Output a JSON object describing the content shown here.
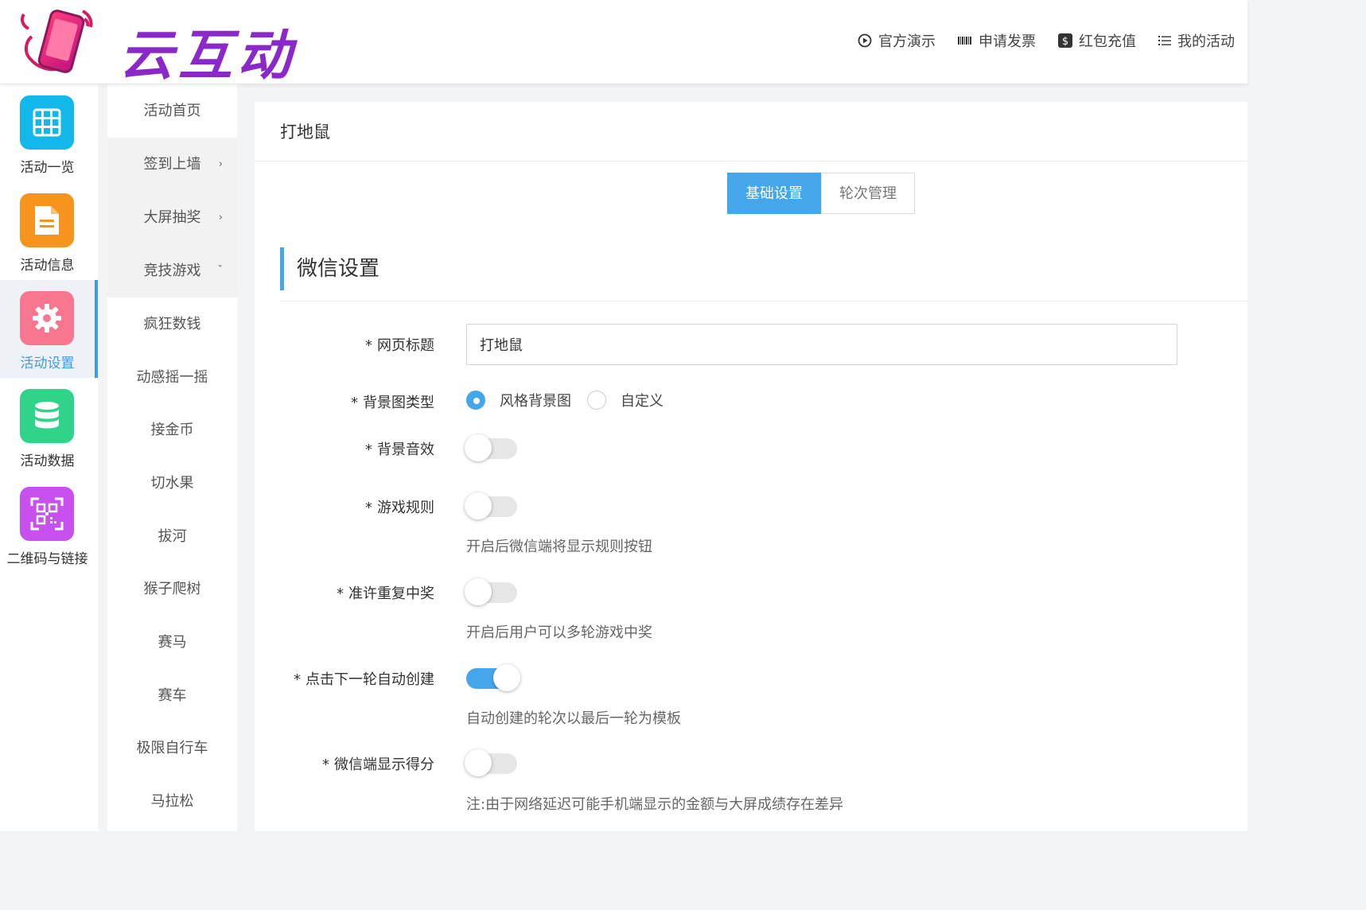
{
  "header": {
    "logo_text": "云互动",
    "nav": [
      {
        "label": "官方演示",
        "icon": "play-circle-icon"
      },
      {
        "label": "申请发票",
        "icon": "barcode-icon"
      },
      {
        "label": "红包充值",
        "icon": "dollar-icon"
      },
      {
        "label": "我的活动",
        "icon": "list-icon"
      }
    ]
  },
  "sidebar": {
    "items": [
      {
        "label": "活动一览",
        "icon": "grid-icon",
        "color": "#13b8ea"
      },
      {
        "label": "活动信息",
        "icon": "document-icon",
        "color": "#f7941d"
      },
      {
        "label": "活动设置",
        "icon": "gear-icon",
        "color": "#f87690"
      },
      {
        "label": "活动数据",
        "icon": "database-icon",
        "color": "#2fd48a"
      },
      {
        "label": "二维码与链接",
        "icon": "qrcode-icon",
        "color": "#c850ef"
      }
    ]
  },
  "submenu": {
    "items": [
      {
        "label": "活动首页"
      },
      {
        "label": "签到上墙",
        "chevron": "›"
      },
      {
        "label": "大屏抽奖",
        "chevron": "›"
      },
      {
        "label": "竞技游戏",
        "chevron": "ˇ"
      },
      {
        "label": "疯狂数钱"
      },
      {
        "label": "动感摇一摇"
      },
      {
        "label": "接金币"
      },
      {
        "label": "切水果"
      },
      {
        "label": "拔河"
      },
      {
        "label": "猴子爬树"
      },
      {
        "label": "赛马"
      },
      {
        "label": "赛车"
      },
      {
        "label": "极限自行车"
      },
      {
        "label": "马拉松"
      }
    ]
  },
  "panel": {
    "title": "打地鼠",
    "tabs": [
      {
        "label": "基础设置"
      },
      {
        "label": "轮次管理"
      }
    ],
    "section_title": "微信设置",
    "required_mark": "*",
    "fields": {
      "page_title": {
        "label": "网页标题",
        "value": "打地鼠"
      },
      "bg_type": {
        "label": "背景图类型",
        "options": [
          "风格背景图",
          "自定义"
        ],
        "selected": "风格背景图"
      },
      "bg_sound": {
        "label": "背景音效",
        "on": false
      },
      "game_rules": {
        "label": "游戏规则",
        "on": false,
        "hint": "开启后微信端将显示规则按钮"
      },
      "repeat_win": {
        "label": "准许重复中奖",
        "on": false,
        "hint": "开启后用户可以多轮游戏中奖"
      },
      "auto_create": {
        "label": "点击下一轮自动创建",
        "on": true,
        "hint": "自动创建的轮次以最后一轮为模板"
      },
      "show_score": {
        "label": "微信端显示得分",
        "on": false,
        "hint": "注:由于网络延迟可能手机端显示的金额与大屏成绩存在差异"
      }
    }
  },
  "colors": {
    "accent": "#45a6ea",
    "logo": "#8a28c9"
  }
}
